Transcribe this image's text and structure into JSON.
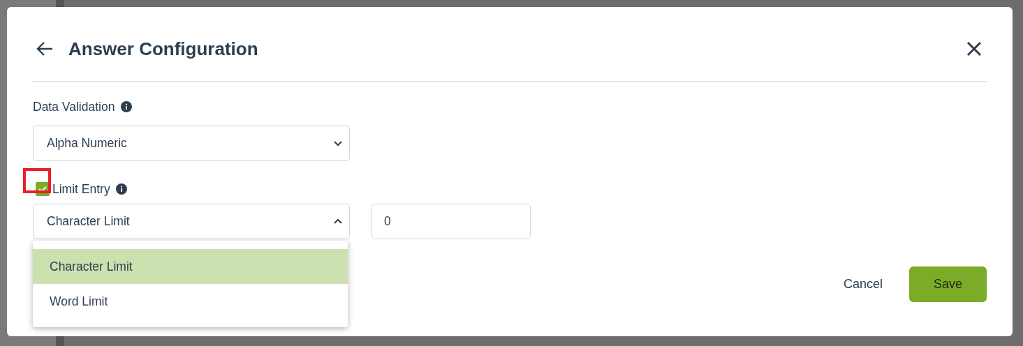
{
  "dialog": {
    "title": "Answer Configuration"
  },
  "data_validation": {
    "label": "Data Validation",
    "value": "Alpha Numeric",
    "expanded": false
  },
  "limit_entry": {
    "label": "Limit Entry",
    "checked": true,
    "highlighted": true
  },
  "limit_type": {
    "value": "Character Limit",
    "expanded": true,
    "options": [
      {
        "label": "Character Limit",
        "selected": true
      },
      {
        "label": "Word Limit",
        "selected": false
      }
    ]
  },
  "limit_value": {
    "value": "0"
  },
  "buttons": [
    {
      "label": "Cancel",
      "kind": "secondary"
    },
    {
      "label": "Save",
      "kind": "primary"
    }
  ]
}
